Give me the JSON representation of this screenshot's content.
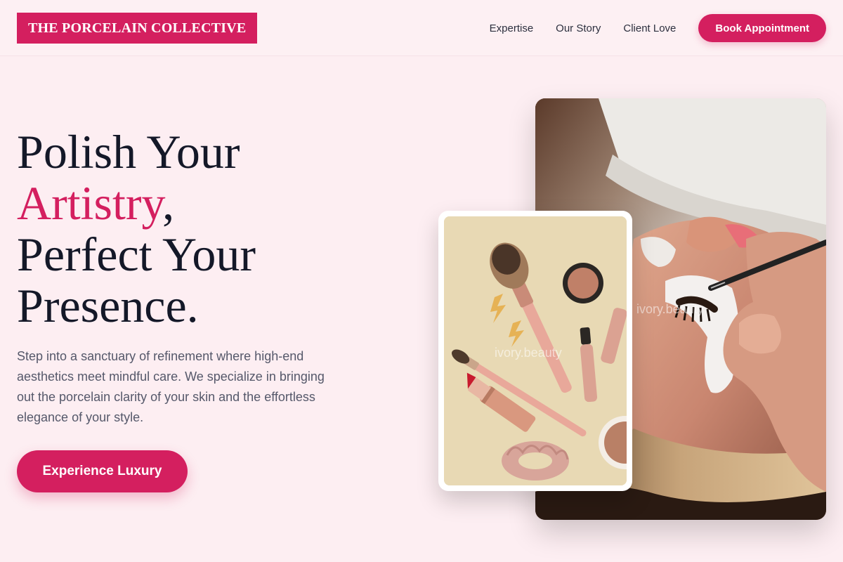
{
  "brand": {
    "name": "THE PORCELAIN COLLECTIVE"
  },
  "nav": {
    "links": [
      "Expertise",
      "Our Story",
      "Client Love"
    ],
    "cta": "Book Appointment"
  },
  "hero": {
    "headline_line1": "Polish Your",
    "headline_accent": "Artistry",
    "headline_comma": ",",
    "headline_line3": "Perfect Your",
    "headline_line4": "Presence.",
    "description": "Step into a sanctuary of refinement where high-end aesthetics meet mindful care. We specialize in bringing out the porcelain clarity of your skin and the effortless elegance of your style.",
    "cta": "Experience Luxury"
  },
  "images": {
    "main_watermark": "ivory.beauty",
    "card_watermark": "ivory.beauty"
  },
  "colors": {
    "accent": "#d41f5f",
    "background": "#fdeef2",
    "text": "#141828"
  }
}
